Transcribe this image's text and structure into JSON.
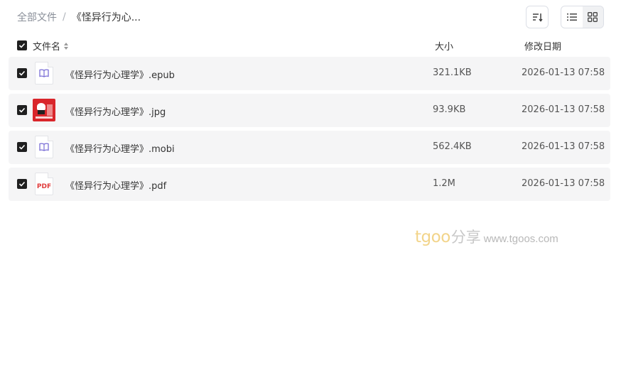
{
  "breadcrumb": {
    "root": "全部文件",
    "separator": "/",
    "current": "《怪异行为心..."
  },
  "toolbar": {
    "sort_icon": "sort-icon",
    "list_view_icon": "list-view-icon",
    "grid_view_icon": "grid-view-icon"
  },
  "table": {
    "columns": {
      "name": "文件名",
      "size": "大小",
      "date": "修改日期"
    },
    "rows": [
      {
        "name": "《怪异行为心理学》.epub",
        "size": "321.1KB",
        "date": "2026-01-13 07:58",
        "icon": "ebook-icon",
        "checked": true
      },
      {
        "name": "《怪异行为心理学》.jpg",
        "size": "93.9KB",
        "date": "2026-01-13 07:58",
        "icon": "image-thumbnail",
        "checked": true
      },
      {
        "name": "《怪异行为心理学》.mobi",
        "size": "562.4KB",
        "date": "2026-01-13 07:58",
        "icon": "ebook-icon",
        "checked": true
      },
      {
        "name": "《怪异行为心理学》.pdf",
        "size": "1.2M",
        "date": "2026-01-13 07:58",
        "icon": "pdf-icon",
        "checked": true
      }
    ]
  },
  "watermark": {
    "brand": "tgoo",
    "cn": "分享",
    "url": "www.tgoos.com"
  },
  "colors": {
    "row_bg": "#f5f5f6",
    "checkbox": "#1f1f1f",
    "ebook_icon": "#7b6fd6",
    "pdf": "#e03b3b",
    "watermark_brand": "#f2d48a"
  },
  "pdf_badge": "PDF"
}
